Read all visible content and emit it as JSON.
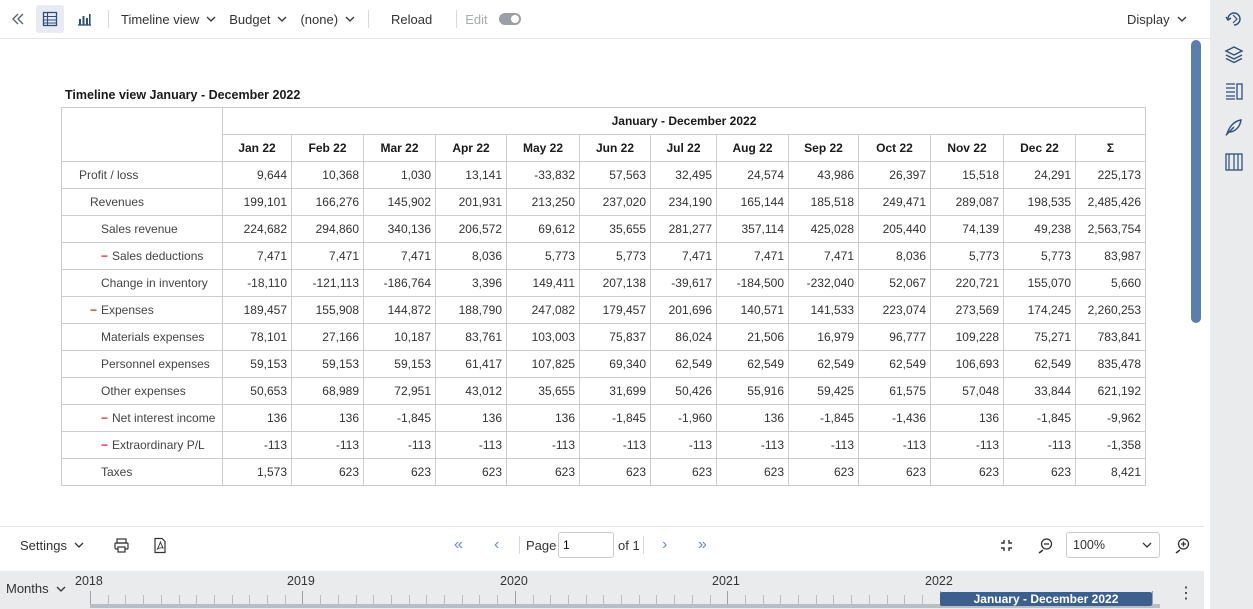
{
  "toolbar": {
    "collapse_icon": "double-chevron-left-icon",
    "view_label": "Timeline view",
    "version_label": "Budget",
    "compare_label": "(none)",
    "reload_label": "Reload",
    "edit_label": "Edit",
    "edit_enabled": false,
    "display_label": "Display"
  },
  "report": {
    "title": "Timeline view January - December 2022",
    "period_header": "January - December 2022",
    "columns": [
      "Jan 22",
      "Feb 22",
      "Mar 22",
      "Apr 22",
      "May 22",
      "Jun 22",
      "Jul 22",
      "Aug 22",
      "Sep 22",
      "Oct 22",
      "Nov 22",
      "Dec 22",
      "Σ"
    ],
    "rows": [
      {
        "label": "Profit / loss",
        "level": 0,
        "expand": false,
        "values": [
          "9,644",
          "10,368",
          "1,030",
          "13,141",
          "-33,832",
          "57,563",
          "32,495",
          "24,574",
          "43,986",
          "26,397",
          "15,518",
          "24,291",
          "225,173"
        ]
      },
      {
        "label": "Revenues",
        "level": 1,
        "expand": false,
        "values": [
          "199,101",
          "166,276",
          "145,902",
          "201,931",
          "213,250",
          "237,020",
          "234,190",
          "165,144",
          "185,518",
          "249,471",
          "289,087",
          "198,535",
          "2,485,426"
        ]
      },
      {
        "label": "Sales revenue",
        "level": 2,
        "expand": false,
        "values": [
          "224,682",
          "294,860",
          "340,136",
          "206,572",
          "69,612",
          "35,655",
          "281,277",
          "357,114",
          "425,028",
          "205,440",
          "74,139",
          "49,238",
          "2,563,754"
        ]
      },
      {
        "label": "Sales deductions",
        "level": 2,
        "expand": true,
        "values": [
          "7,471",
          "7,471",
          "7,471",
          "8,036",
          "5,773",
          "5,773",
          "7,471",
          "7,471",
          "7,471",
          "8,036",
          "5,773",
          "5,773",
          "83,987"
        ]
      },
      {
        "label": "Change in inventory",
        "level": 2,
        "expand": false,
        "values": [
          "-18,110",
          "-121,113",
          "-186,764",
          "3,396",
          "149,411",
          "207,138",
          "-39,617",
          "-184,500",
          "-232,040",
          "52,067",
          "220,721",
          "155,070",
          "5,660"
        ]
      },
      {
        "label": "Expenses",
        "level": 1,
        "expand": true,
        "values": [
          "189,457",
          "155,908",
          "144,872",
          "188,790",
          "247,082",
          "179,457",
          "201,696",
          "140,571",
          "141,533",
          "223,074",
          "273,569",
          "174,245",
          "2,260,253"
        ]
      },
      {
        "label": "Materials expenses",
        "level": 2,
        "expand": false,
        "values": [
          "78,101",
          "27,166",
          "10,187",
          "83,761",
          "103,003",
          "75,837",
          "86,024",
          "21,506",
          "16,979",
          "96,777",
          "109,228",
          "75,271",
          "783,841"
        ]
      },
      {
        "label": "Personnel expenses",
        "level": 2,
        "expand": false,
        "values": [
          "59,153",
          "59,153",
          "59,153",
          "61,417",
          "107,825",
          "69,340",
          "62,549",
          "62,549",
          "62,549",
          "62,549",
          "106,693",
          "62,549",
          "835,478"
        ]
      },
      {
        "label": "Other expenses",
        "level": 2,
        "expand": false,
        "values": [
          "50,653",
          "68,989",
          "72,951",
          "43,012",
          "35,655",
          "31,699",
          "50,426",
          "55,916",
          "59,425",
          "61,575",
          "57,048",
          "33,844",
          "621,192"
        ]
      },
      {
        "label": "Net interest income",
        "level": 2,
        "expand": true,
        "values": [
          "136",
          "136",
          "-1,845",
          "136",
          "136",
          "-1,845",
          "-1,960",
          "136",
          "-1,845",
          "-1,436",
          "136",
          "-1,845",
          "-9,962"
        ]
      },
      {
        "label": "Extraordinary P/L",
        "level": 2,
        "expand": true,
        "values": [
          "-113",
          "-113",
          "-113",
          "-113",
          "-113",
          "-113",
          "-113",
          "-113",
          "-113",
          "-113",
          "-113",
          "-113",
          "-1,358"
        ]
      },
      {
        "label": "Taxes",
        "level": 2,
        "expand": false,
        "values": [
          "1,573",
          "623",
          "623",
          "623",
          "623",
          "623",
          "623",
          "623",
          "623",
          "623",
          "623",
          "623",
          "8,421"
        ]
      }
    ]
  },
  "bottombar": {
    "settings_label": "Settings",
    "page_label": "Page",
    "page_value": "1",
    "of_label": "of 1",
    "zoom_value": "100%"
  },
  "timeline": {
    "granularity_label": "Months",
    "years": [
      "2018",
      "2019",
      "2020",
      "2021",
      "2022"
    ],
    "selected_range": "January - December 2022"
  },
  "colors": {
    "accent": "#3d5f8e",
    "scrollbar": "#5b7fa8",
    "expand_marker": "#d9342b",
    "nav_icon": "#6b8fbf"
  }
}
